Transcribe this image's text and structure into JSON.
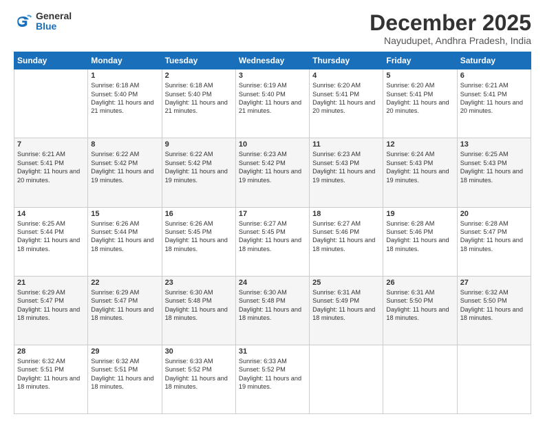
{
  "logo": {
    "general": "General",
    "blue": "Blue"
  },
  "header": {
    "month": "December 2025",
    "location": "Nayudupet, Andhra Pradesh, India"
  },
  "weekdays": [
    "Sunday",
    "Monday",
    "Tuesday",
    "Wednesday",
    "Thursday",
    "Friday",
    "Saturday"
  ],
  "weeks": [
    [
      {
        "day": null,
        "content": ""
      },
      {
        "day": "1",
        "sunrise": "6:18 AM",
        "sunset": "5:40 PM",
        "daylight": "11 hours and 21 minutes."
      },
      {
        "day": "2",
        "sunrise": "6:18 AM",
        "sunset": "5:40 PM",
        "daylight": "11 hours and 21 minutes."
      },
      {
        "day": "3",
        "sunrise": "6:19 AM",
        "sunset": "5:40 PM",
        "daylight": "11 hours and 21 minutes."
      },
      {
        "day": "4",
        "sunrise": "6:20 AM",
        "sunset": "5:41 PM",
        "daylight": "11 hours and 20 minutes."
      },
      {
        "day": "5",
        "sunrise": "6:20 AM",
        "sunset": "5:41 PM",
        "daylight": "11 hours and 20 minutes."
      },
      {
        "day": "6",
        "sunrise": "6:21 AM",
        "sunset": "5:41 PM",
        "daylight": "11 hours and 20 minutes."
      }
    ],
    [
      {
        "day": "7",
        "sunrise": "6:21 AM",
        "sunset": "5:41 PM",
        "daylight": "11 hours and 20 minutes."
      },
      {
        "day": "8",
        "sunrise": "6:22 AM",
        "sunset": "5:42 PM",
        "daylight": "11 hours and 19 minutes."
      },
      {
        "day": "9",
        "sunrise": "6:22 AM",
        "sunset": "5:42 PM",
        "daylight": "11 hours and 19 minutes."
      },
      {
        "day": "10",
        "sunrise": "6:23 AM",
        "sunset": "5:42 PM",
        "daylight": "11 hours and 19 minutes."
      },
      {
        "day": "11",
        "sunrise": "6:23 AM",
        "sunset": "5:43 PM",
        "daylight": "11 hours and 19 minutes."
      },
      {
        "day": "12",
        "sunrise": "6:24 AM",
        "sunset": "5:43 PM",
        "daylight": "11 hours and 19 minutes."
      },
      {
        "day": "13",
        "sunrise": "6:25 AM",
        "sunset": "5:43 PM",
        "daylight": "11 hours and 18 minutes."
      }
    ],
    [
      {
        "day": "14",
        "sunrise": "6:25 AM",
        "sunset": "5:44 PM",
        "daylight": "11 hours and 18 minutes."
      },
      {
        "day": "15",
        "sunrise": "6:26 AM",
        "sunset": "5:44 PM",
        "daylight": "11 hours and 18 minutes."
      },
      {
        "day": "16",
        "sunrise": "6:26 AM",
        "sunset": "5:45 PM",
        "daylight": "11 hours and 18 minutes."
      },
      {
        "day": "17",
        "sunrise": "6:27 AM",
        "sunset": "5:45 PM",
        "daylight": "11 hours and 18 minutes."
      },
      {
        "day": "18",
        "sunrise": "6:27 AM",
        "sunset": "5:46 PM",
        "daylight": "11 hours and 18 minutes."
      },
      {
        "day": "19",
        "sunrise": "6:28 AM",
        "sunset": "5:46 PM",
        "daylight": "11 hours and 18 minutes."
      },
      {
        "day": "20",
        "sunrise": "6:28 AM",
        "sunset": "5:47 PM",
        "daylight": "11 hours and 18 minutes."
      }
    ],
    [
      {
        "day": "21",
        "sunrise": "6:29 AM",
        "sunset": "5:47 PM",
        "daylight": "11 hours and 18 minutes."
      },
      {
        "day": "22",
        "sunrise": "6:29 AM",
        "sunset": "5:47 PM",
        "daylight": "11 hours and 18 minutes."
      },
      {
        "day": "23",
        "sunrise": "6:30 AM",
        "sunset": "5:48 PM",
        "daylight": "11 hours and 18 minutes."
      },
      {
        "day": "24",
        "sunrise": "6:30 AM",
        "sunset": "5:48 PM",
        "daylight": "11 hours and 18 minutes."
      },
      {
        "day": "25",
        "sunrise": "6:31 AM",
        "sunset": "5:49 PM",
        "daylight": "11 hours and 18 minutes."
      },
      {
        "day": "26",
        "sunrise": "6:31 AM",
        "sunset": "5:50 PM",
        "daylight": "11 hours and 18 minutes."
      },
      {
        "day": "27",
        "sunrise": "6:32 AM",
        "sunset": "5:50 PM",
        "daylight": "11 hours and 18 minutes."
      }
    ],
    [
      {
        "day": "28",
        "sunrise": "6:32 AM",
        "sunset": "5:51 PM",
        "daylight": "11 hours and 18 minutes."
      },
      {
        "day": "29",
        "sunrise": "6:32 AM",
        "sunset": "5:51 PM",
        "daylight": "11 hours and 18 minutes."
      },
      {
        "day": "30",
        "sunrise": "6:33 AM",
        "sunset": "5:52 PM",
        "daylight": "11 hours and 18 minutes."
      },
      {
        "day": "31",
        "sunrise": "6:33 AM",
        "sunset": "5:52 PM",
        "daylight": "11 hours and 19 minutes."
      },
      {
        "day": null,
        "content": ""
      },
      {
        "day": null,
        "content": ""
      },
      {
        "day": null,
        "content": ""
      }
    ]
  ]
}
